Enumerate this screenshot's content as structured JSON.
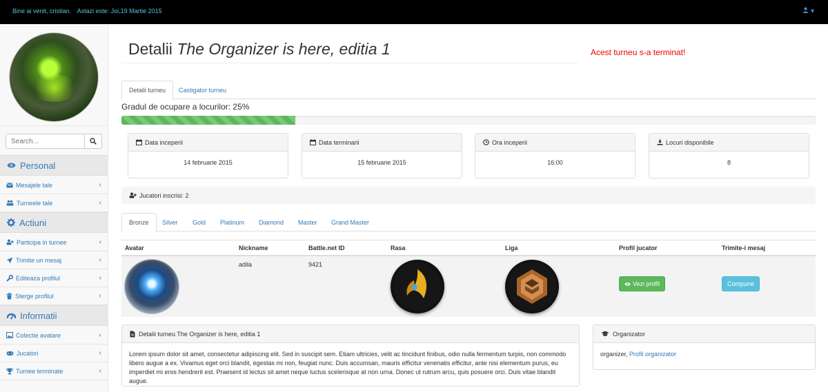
{
  "topbar": {
    "welcome": "Bine ai venit, cristian.",
    "date": "Astazi este: Joi,19 Martie 2015",
    "user_menu_caret": "▾"
  },
  "sidebar": {
    "search_placeholder": "Search...",
    "sections": [
      {
        "title": "Personal",
        "icon": "eye-icon",
        "items": [
          {
            "label": "Mesajele tale",
            "icon": "envelope-icon"
          },
          {
            "label": "Turneele tale",
            "icon": "users-icon"
          }
        ]
      },
      {
        "title": "Actiuni",
        "icon": "gear-icon",
        "items": [
          {
            "label": "Participa in turnee",
            "icon": "user-plus-icon"
          },
          {
            "label": "Trimite un mesaj",
            "icon": "paper-plane-icon"
          },
          {
            "label": "Editeaza profilul",
            "icon": "wrench-icon"
          },
          {
            "label": "Sterge profilul",
            "icon": "trash-icon"
          }
        ]
      },
      {
        "title": "Informatii",
        "icon": "dashboard-icon",
        "items": [
          {
            "label": "Colectie avatare",
            "icon": "image-icon"
          },
          {
            "label": "Jucatori",
            "icon": "gamepad-icon"
          },
          {
            "label": "Turnee terminate",
            "icon": "trophy-icon"
          }
        ]
      }
    ],
    "chevron": "‹"
  },
  "page": {
    "title_prefix": "Detalii",
    "title_name": "The Organizer is here, editia 1",
    "status": "Acest turneu s-a terminat!",
    "status_color": "#e00000"
  },
  "tabs_top": [
    {
      "label": "Detalii turneu",
      "active": true
    },
    {
      "label": "Castigator turneu",
      "active": false
    }
  ],
  "occupancy": {
    "label": "Gradul de ocupare a locurilor: 25%",
    "percent": 25
  },
  "info_cards": [
    {
      "label": "Data inceperii",
      "value": "14 februarie 2015",
      "icon": "calendar-icon"
    },
    {
      "label": "Data terminarii",
      "value": "15 februarie 2015",
      "icon": "calendar-icon"
    },
    {
      "label": "Ora inceperii",
      "value": "16:00",
      "icon": "clock-icon"
    },
    {
      "label": "Locuri disponibile",
      "value": "8",
      "icon": "download-icon"
    }
  ],
  "players_bar": "Jucatori inscrisi: 2",
  "league_tabs": [
    {
      "label": "Bronze",
      "active": true
    },
    {
      "label": "Silver",
      "active": false
    },
    {
      "label": "Gold",
      "active": false
    },
    {
      "label": "Platinum",
      "active": false
    },
    {
      "label": "Diamond",
      "active": false
    },
    {
      "label": "Master",
      "active": false
    },
    {
      "label": "Grand Master",
      "active": false
    }
  ],
  "table": {
    "headers": [
      "Avatar",
      "Nickname",
      "Battle.net ID",
      "Rasa",
      "Liga",
      "Profil jucator",
      "Trimite-i mesaj"
    ],
    "rows": [
      {
        "nickname": "adila",
        "battlenet_id": "9421",
        "profile_button": "Vezi profil",
        "message_button": "Compune"
      }
    ]
  },
  "details_panel": {
    "title": "Detalii turneu The Organizer is here, editia 1",
    "body": "Lorem ipsum dolor sit amet, consectetur adipiscing elit. Sed in suscipit sem. Etiam ultricies, velit ac tincidunt finibus, odio nulla fermentum turpis, non commodo libero augue a ex. Vivamus eget orci blandit, egestas mi non, feugiat nunc. Duis accumsan, mauris efficitur venenatis efficitur, ante nisi elementum purus, eu imperdiet mi eros hendrerit est. Praesent id lectus sit amet neque luctus scelerisque at non urna. Donec ut rutrum arcu, quis posuere orci. Duis vitae blandit augue."
  },
  "organizer_panel": {
    "title": "Organizator",
    "name": "organizer,",
    "link": "Profil organizator"
  },
  "colors": {
    "accent": "#337ab7",
    "success": "#5cb85c",
    "info": "#5bc0de",
    "topbar_text": "#5bc0de"
  }
}
